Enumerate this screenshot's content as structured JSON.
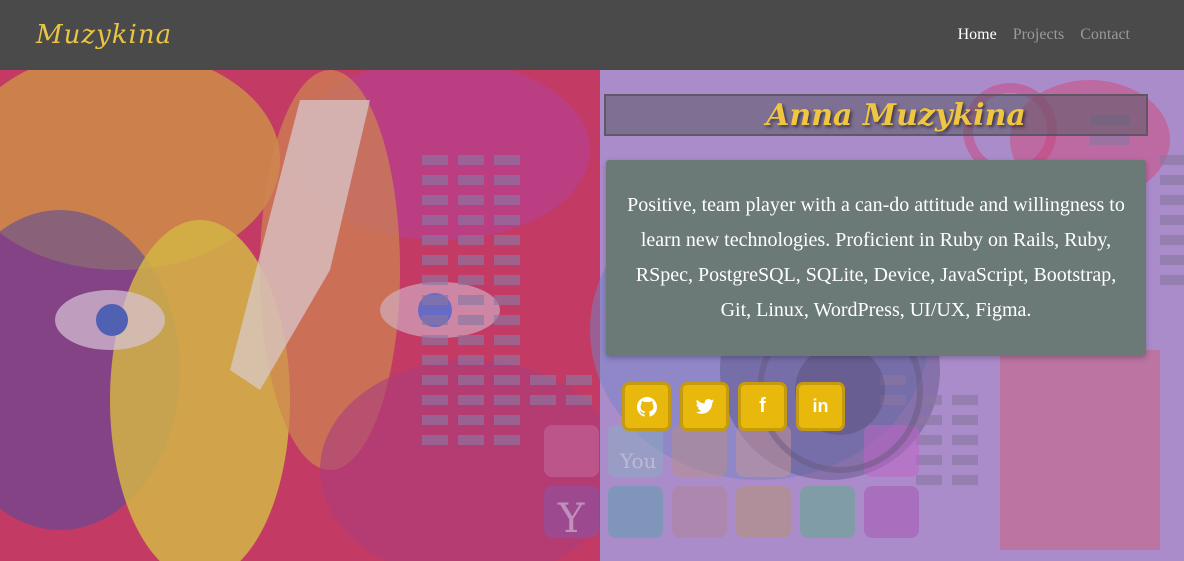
{
  "navbar": {
    "brand": "Muzykina",
    "links": [
      {
        "label": "Home",
        "active": true
      },
      {
        "label": "Projects",
        "active": false
      },
      {
        "label": "Contact",
        "active": false
      }
    ]
  },
  "hero": {
    "name": "Anna Muzykina",
    "bio": "Positive, team player with a can-do attitude and willingness to learn new technologies. Proficient in Ruby on Rails, Ruby, RSpec, PostgreSQL, SQLite, Device, JavaScript, Bootstrap, Git, Linux, WordPress, UI/UX, Figma.",
    "socials": [
      {
        "icon": "github-icon"
      },
      {
        "icon": "twitter-icon"
      },
      {
        "icon": "facebook-icon"
      },
      {
        "icon": "linkedin-icon"
      }
    ]
  },
  "colors": {
    "navbar_bg": "#4a4a4a",
    "brand": "#e8c544",
    "nav_active": "#ffffff",
    "nav_inactive": "#9a9a9a",
    "bio_card_bg": "#6c7a77",
    "social_btn_bg": "#e8b80c"
  }
}
